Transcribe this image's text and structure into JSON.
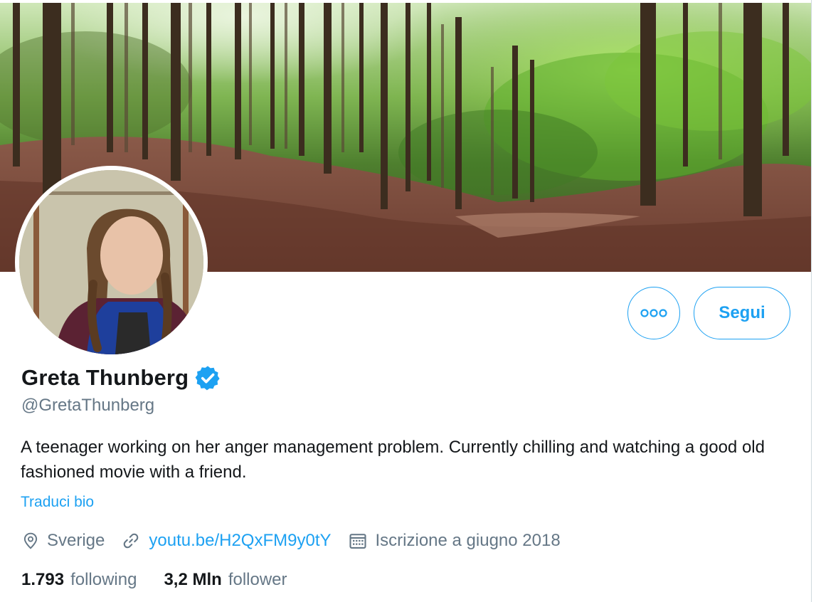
{
  "profile": {
    "name": "Greta Thunberg",
    "handle": "@GretaThunberg",
    "verified": true,
    "bio": "A teenager working on her anger management problem. Currently chilling and watching a good old fashioned movie with a friend.",
    "translate_label": "Traduci bio",
    "location": "Sverige",
    "website": "youtu.be/H2QxFM9y0tY",
    "joined": "Iscrizione a giugno 2018"
  },
  "actions": {
    "follow_label": "Segui"
  },
  "stats": {
    "following_count": "1.793",
    "following_label": "following",
    "followers_count": "3,2 Mln",
    "followers_label": "follower"
  },
  "icons": {
    "more": "more-options-icon",
    "verified": "verified-badge-icon",
    "location": "location-pin-icon",
    "link": "link-icon",
    "calendar": "calendar-icon"
  },
  "colors": {
    "accent": "#1da1f2",
    "text_primary": "#14171a",
    "text_secondary": "#657786"
  }
}
